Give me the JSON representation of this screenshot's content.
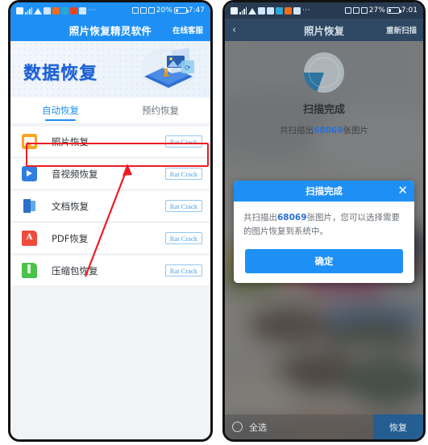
{
  "left_phone": {
    "status_bar": {
      "battery": "20%",
      "time": "7:47",
      "icons": [
        "photo-icon",
        "signal-icon",
        "wifi-icon",
        "mute-icon",
        "alarm-icon",
        "app-icon",
        "app-icon-2",
        "person-icon",
        "more-dots-icon"
      ]
    },
    "header": {
      "title": "照片恢复精灵软件",
      "service_label": "在线客服"
    },
    "banner": {
      "title": "数据恢复"
    },
    "tabs": [
      {
        "label": "自动恢复",
        "active": true
      },
      {
        "label": "预约恢复",
        "active": false
      }
    ],
    "list": [
      {
        "label": "照片恢复",
        "icon": "photo-file-icon",
        "action": "Rat Crack",
        "highlighted": true
      },
      {
        "label": "音视频恢复",
        "icon": "video-file-icon",
        "action": "Rat Crack",
        "highlighted": false
      },
      {
        "label": "文档恢复",
        "icon": "document-file-icon",
        "action": "Rat Crack",
        "highlighted": false
      },
      {
        "label": "PDF恢复",
        "icon": "pdf-file-icon",
        "action": "Rat Crack",
        "highlighted": false
      },
      {
        "label": "压缩包恢复",
        "icon": "archive-file-icon",
        "action": "Rat Crack",
        "highlighted": false
      }
    ],
    "annotation": {
      "box_color": "#ED1C24",
      "arrow_color": "#ED1C24",
      "target": "照片恢复"
    }
  },
  "right_phone": {
    "status_bar": {
      "battery": "27%",
      "time": "7:01"
    },
    "header": {
      "back": "‹",
      "title": "照片恢复",
      "rescan_label": "重新扫描"
    },
    "scan": {
      "title": "扫描完成",
      "subtitle_prefix": "共扫描出",
      "count": "68069",
      "subtitle_suffix": "张图片"
    },
    "dialog": {
      "title": "扫描完成",
      "close_icon": "✕",
      "message_prefix": "共扫描出",
      "message_count": "68069",
      "message_suffix": "张图片，您可以选择需要的图片恢复到系统中。",
      "confirm_label": "确定"
    },
    "bottom_bar": {
      "select_all_label": "全选",
      "recover_label": "恢复"
    }
  },
  "colors": {
    "brand_blue": "#1E90F5",
    "link_blue": "#2a6fd8",
    "annotation_red": "#ED1C24",
    "banner_title_blue": "#1a5fd4"
  }
}
